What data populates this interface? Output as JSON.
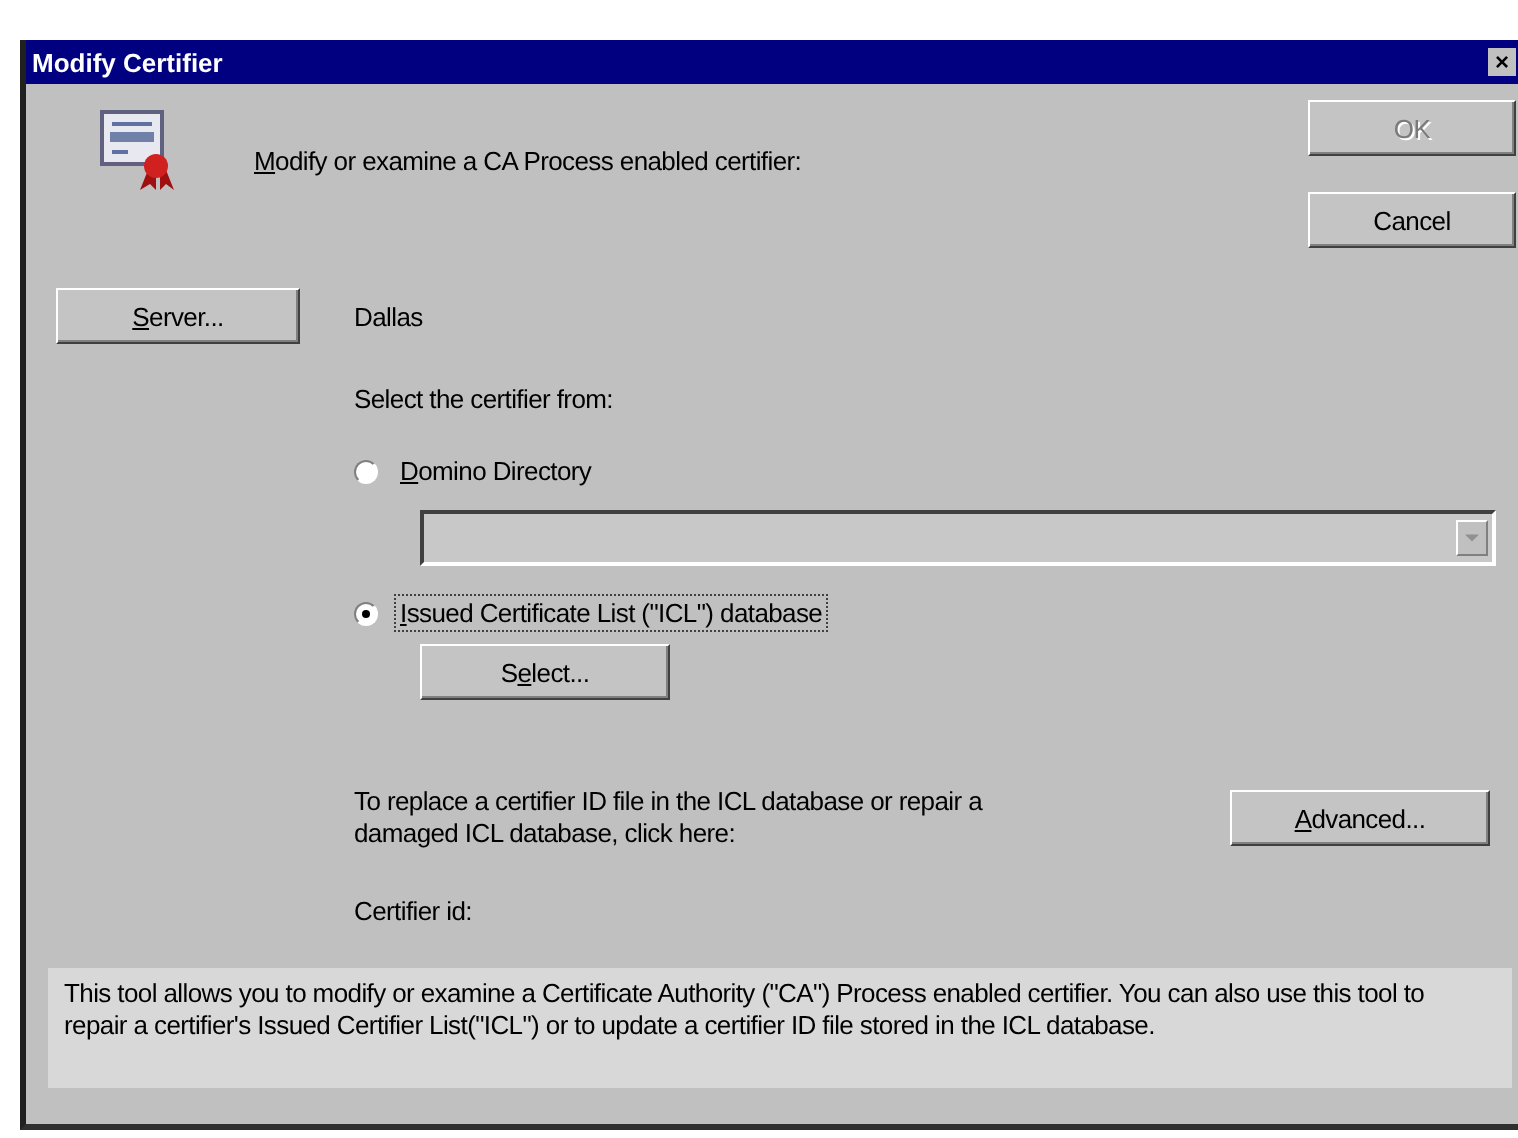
{
  "window": {
    "title": "Modify Certifier",
    "close_icon": "×"
  },
  "header": {
    "text": {
      "key": "M",
      "post": "odify or examine a CA Process enabled certifier:"
    }
  },
  "buttons": [
    {
      "label": "OK",
      "disabled": true
    },
    {
      "label": "Cancel",
      "disabled": false
    }
  ],
  "server": {
    "button": {
      "label": {
        "key": "S",
        "post": "erver..."
      }
    },
    "value": "Dallas"
  },
  "source": {
    "label": "Select the certifier from:",
    "options": [
      {
        "label": {
          "key": "D",
          "post": "omino Directory"
        },
        "selected": false
      },
      {
        "label": {
          "key": "I",
          "post": "ssued Certificate List (\"ICL\") database"
        },
        "selected": true
      }
    ],
    "select_button": {
      "label": {
        "pre": "S",
        "key": "e",
        "post": "lect..."
      }
    }
  },
  "advanced": {
    "text": "To replace a certifier ID file in the ICL database or  repair a damaged ICL database, click here:",
    "button": {
      "label": {
        "key": "A",
        "post": "dvanced..."
      }
    }
  },
  "certifier_id": {
    "label": "Certifier id:"
  },
  "description": "This tool allows you to modify or examine a Certificate Authority (\"CA\") Process enabled certifier.  You can also use this tool to repair a certifier's Issued Certifier List(\"ICL\") or to update a certifier ID file stored in the ICL database."
}
